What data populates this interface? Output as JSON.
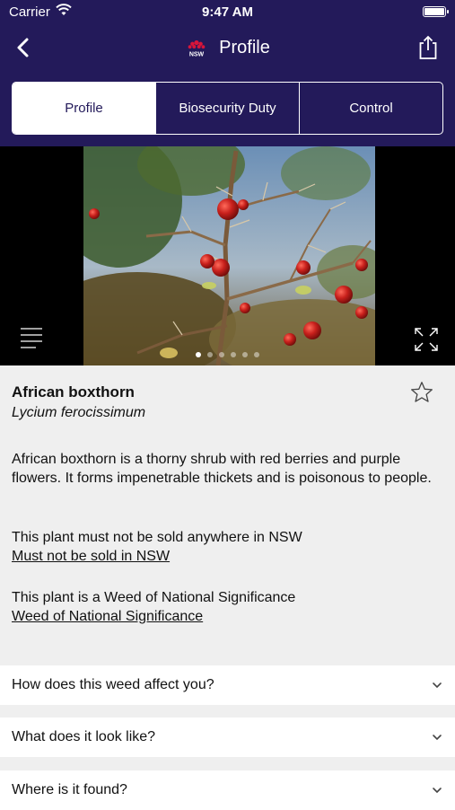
{
  "status_bar": {
    "carrier": "Carrier",
    "time": "9:47 AM"
  },
  "nav": {
    "title": "Profile",
    "logo_text": "NSW"
  },
  "tabs": [
    {
      "label": "Profile",
      "selected": true
    },
    {
      "label": "Biosecurity Duty",
      "selected": false
    },
    {
      "label": "Control",
      "selected": false
    }
  ],
  "gallery": {
    "image_count": 6,
    "active_index": 0
  },
  "plant": {
    "common_name": "African boxthorn",
    "scientific_name": "Lycium ferocissimum",
    "description": "African boxthorn is a thorny shrub with red berries and purple flowers. It forms impenetrable thickets and is poisonous to people.",
    "sale_text": "This plant must not be sold anywhere in NSW",
    "sale_link": "Must not be sold in NSW",
    "wons_text": "This plant is a Weed of National Significance",
    "wons_link": "Weed of National Significance"
  },
  "accordion": [
    {
      "label": "How does this weed affect you?"
    },
    {
      "label": "What does it look like?"
    },
    {
      "label": "Where is it found?"
    }
  ],
  "colors": {
    "header": "#231a5a",
    "background": "#efefef",
    "berry": "#c8201c"
  }
}
